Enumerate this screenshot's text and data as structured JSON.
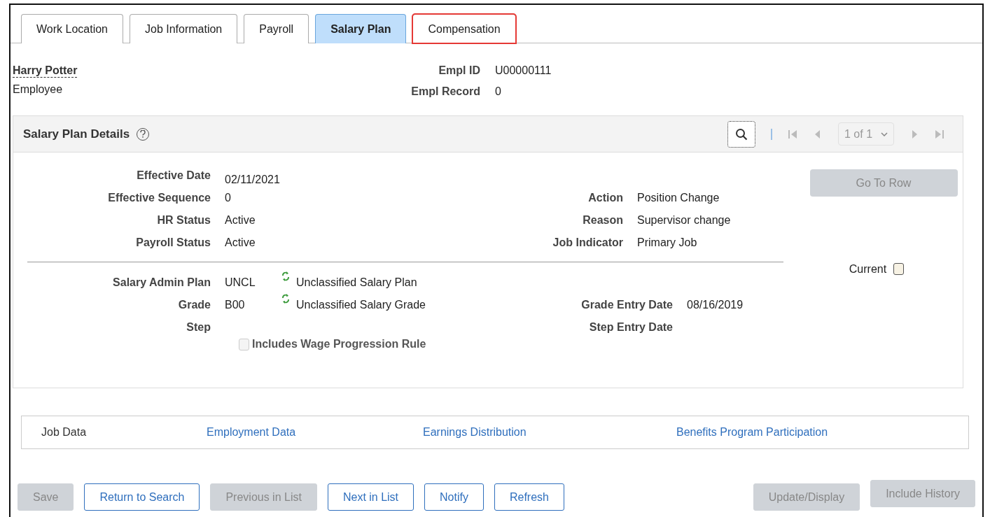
{
  "tabs": [
    {
      "label": "Work Location",
      "selected": false,
      "highlighted": false
    },
    {
      "label": "Job Information",
      "selected": false,
      "highlighted": false
    },
    {
      "label": "Payroll",
      "selected": false,
      "highlighted": false
    },
    {
      "label": "Salary Plan",
      "selected": true,
      "highlighted": false
    },
    {
      "label": "Compensation",
      "selected": false,
      "highlighted": true
    }
  ],
  "employee": {
    "name": "Harry Potter",
    "type": "Employee",
    "fields": [
      {
        "label": "Empl ID",
        "value": "U00000111"
      },
      {
        "label": "Empl Record",
        "value": "0"
      }
    ]
  },
  "panel": {
    "title": "Salary Plan Details",
    "pager": "1 of 1",
    "go_to_row": {
      "label": "Go To Row",
      "disabled": true
    },
    "first_value": {
      "label": "Effective Date",
      "value": "02/11/2021"
    },
    "left_fields": [
      {
        "label": "Effective Sequence",
        "value": "0"
      },
      {
        "label": "HR Status",
        "value": "Active"
      },
      {
        "label": "Payroll Status",
        "value": "Active"
      }
    ],
    "right_fields": [
      {
        "label": "Action",
        "value": "Position Change"
      },
      {
        "label": "Reason",
        "value": "Supervisor change"
      },
      {
        "label": "Job Indicator",
        "value": "Primary Job"
      }
    ],
    "current": {
      "label": "Current",
      "checked": false
    },
    "salary_rows": [
      {
        "label": "Salary Admin Plan",
        "value": "UNCL",
        "description": "Unclassified Salary Plan"
      },
      {
        "label": "Grade",
        "value": "B00",
        "description": "Unclassified Salary Grade",
        "right_label": "Grade Entry Date",
        "right_value": "08/16/2019"
      },
      {
        "label": "Step",
        "right_label": "Step Entry Date"
      }
    ],
    "wage_rule": {
      "label": "Includes Wage Progression Rule",
      "checked": false,
      "disabled": true
    }
  },
  "links": [
    {
      "label": "Job Data",
      "selected": true
    },
    {
      "label": "Employment Data",
      "selected": false
    },
    {
      "label": "Earnings Distribution",
      "selected": false
    },
    {
      "label": "Benefits Program Participation",
      "selected": false
    }
  ],
  "buttons": [
    {
      "label": "Save",
      "disabled": true
    },
    {
      "label": "Return to Search",
      "disabled": false
    },
    {
      "label": "Previous in List",
      "disabled": true
    },
    {
      "label": "Next in List",
      "disabled": false
    },
    {
      "label": "Notify",
      "disabled": false
    },
    {
      "label": "Refresh",
      "disabled": false
    }
  ],
  "right_buttons": [
    {
      "label": "Update/Display",
      "disabled": true
    },
    {
      "label": "Include History",
      "disabled": true
    }
  ]
}
